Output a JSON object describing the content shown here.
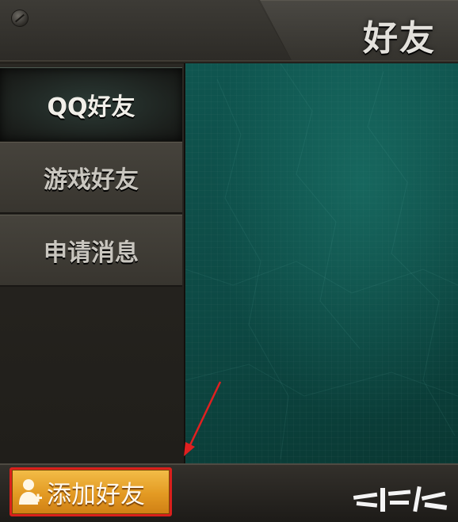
{
  "header": {
    "title": "好友"
  },
  "sidebar": {
    "items": [
      {
        "label": "QQ好友",
        "active": true
      },
      {
        "label": "游戏好友",
        "active": false
      },
      {
        "label": "申请消息",
        "active": false
      }
    ]
  },
  "bottom": {
    "add_friend_label": "添加好友",
    "add_friend_icon": "user-plus-icon"
  },
  "colors": {
    "content_bg": "#0d4a45",
    "button_orange": "#e39a23",
    "highlight_red": "#d9201c"
  }
}
